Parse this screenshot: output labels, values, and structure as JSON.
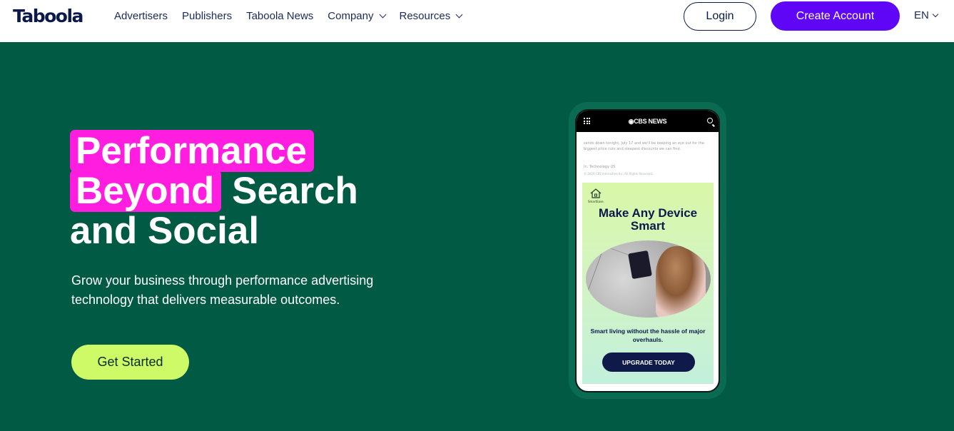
{
  "header": {
    "logo": "Taboola",
    "nav": [
      {
        "label": "Advertisers",
        "dropdown": false
      },
      {
        "label": "Publishers",
        "dropdown": false
      },
      {
        "label": "Taboola News",
        "dropdown": false
      },
      {
        "label": "Company",
        "dropdown": true
      },
      {
        "label": "Resources",
        "dropdown": true
      }
    ],
    "login_label": "Login",
    "create_account_label": "Create Account",
    "language": "EN"
  },
  "hero": {
    "headline_highlight_1": "Performance",
    "headline_highlight_2": "Beyond",
    "headline_rest_2": "Search",
    "headline_line_3": "and Social",
    "subtext": "Grow your business through performance advertising technology that delivers measurable outcomes.",
    "cta_label": "Get Started"
  },
  "phone": {
    "site_brand": "◉CBS NEWS",
    "article_text": "sends down tonight, July 17 and we'll be keeping an eye out for the biggest price cuts and steepest discounts we can find.",
    "tags": "In:  Technology   US",
    "copyright": "© 2024 CBS Interactive Inc. All Rights Reserved.",
    "ad": {
      "brand": "SmartEase.",
      "title": "Make Any Device Smart",
      "copy": "Smart living without the hassle of major overhauls.",
      "button": "UPGRADE TODAY"
    }
  },
  "colors": {
    "hero_bg": "#005a44",
    "accent_purple": "#5f06f6",
    "highlight_pink": "#ff1ee0",
    "cta_green": "#cdfa66",
    "text_navy": "#0b1a4a"
  }
}
